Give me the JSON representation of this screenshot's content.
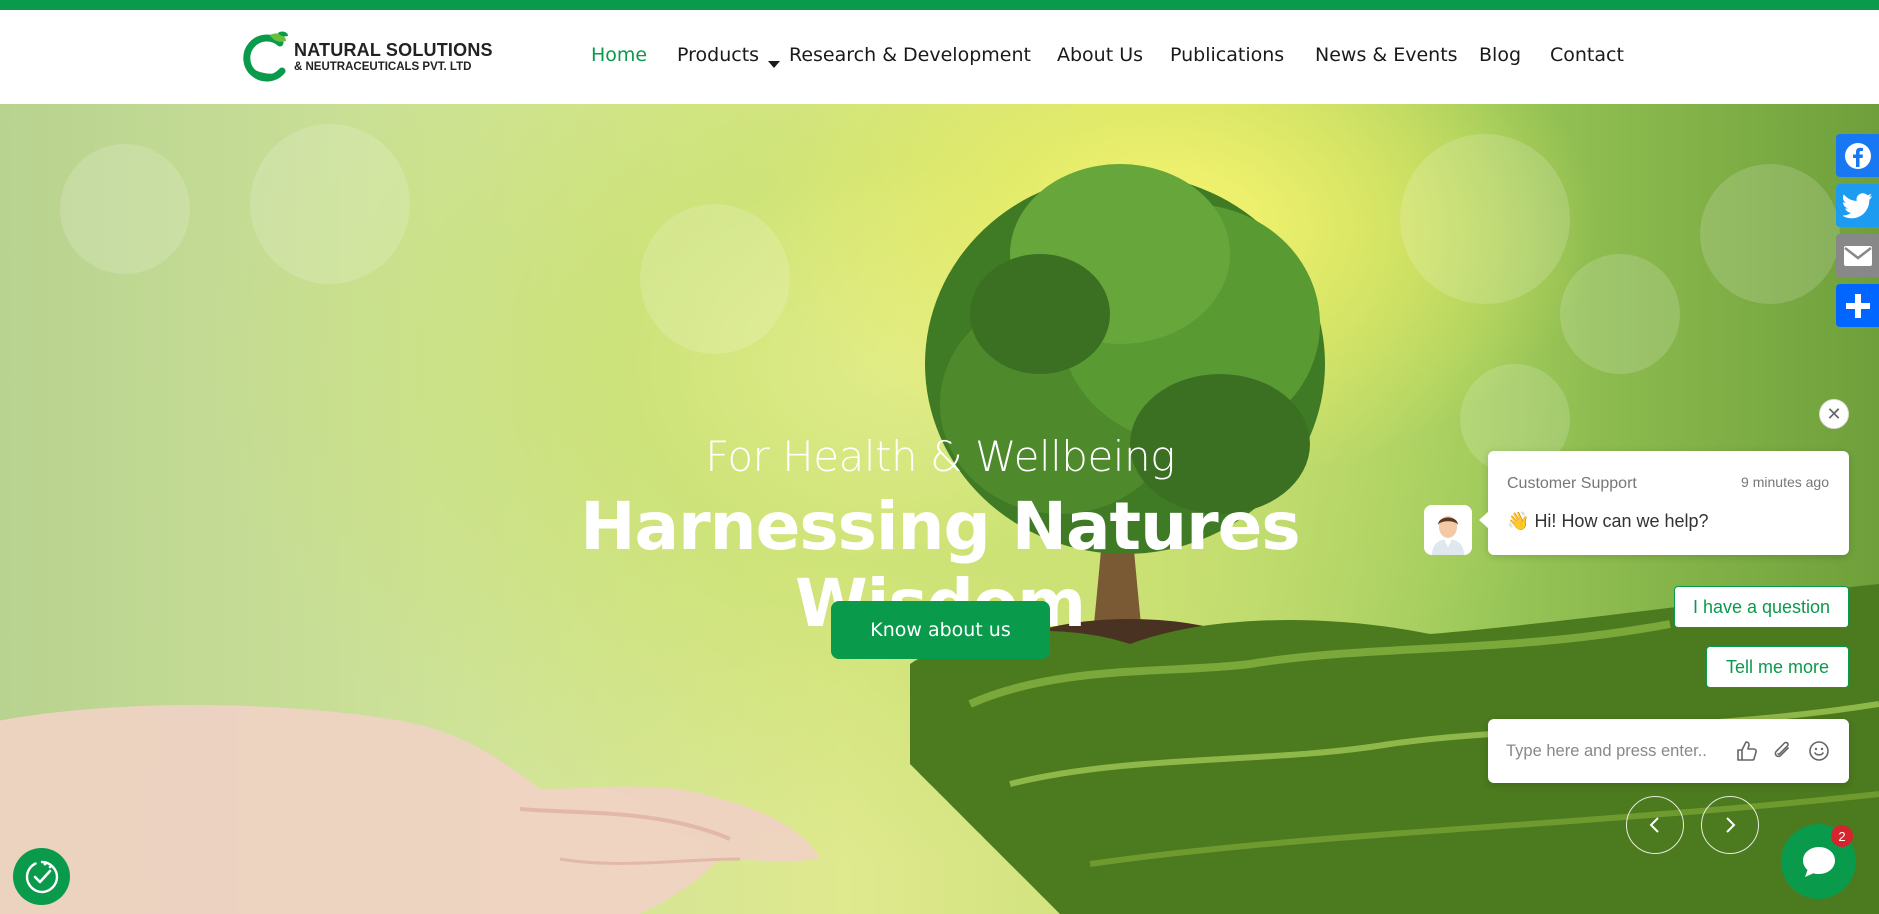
{
  "brand": {
    "name_line1": "NATURAL SOLUTIONS",
    "name_line2": "& NEUTRACEUTICALS PVT. LTD",
    "accent_color": "#0a9a4c"
  },
  "nav": {
    "items": [
      {
        "label": "Home",
        "active": true
      },
      {
        "label": "Products",
        "has_dropdown": true
      },
      {
        "label": "Research & Development"
      },
      {
        "label": "About Us"
      },
      {
        "label": "Publications"
      },
      {
        "label": "News & Events"
      },
      {
        "label": "Blog"
      },
      {
        "label": "Contact"
      }
    ]
  },
  "hero": {
    "subtitle": "For Health & Wellbeing",
    "title": "Harnessing Natures Wisdom",
    "cta_label": "Know about us",
    "prev_icon": "chevron-left-icon",
    "next_icon": "chevron-right-icon"
  },
  "social": {
    "buttons": [
      {
        "name": "facebook",
        "icon": "facebook-icon",
        "color": "#1877f2"
      },
      {
        "name": "twitter",
        "icon": "twitter-icon",
        "color": "#1d9bf0"
      },
      {
        "name": "email",
        "icon": "email-icon",
        "color": "#888888"
      },
      {
        "name": "share",
        "icon": "plus-icon",
        "color": "#0166ff"
      }
    ]
  },
  "chat": {
    "agent_name": "Customer Support",
    "time_ago": "9 minutes ago",
    "greeting_emoji": "👋",
    "greeting": "Hi! How can we help?",
    "quick_replies": [
      "I have a question",
      "Tell me more"
    ],
    "input_placeholder": "Type here and press enter..",
    "unread_count": "2"
  }
}
